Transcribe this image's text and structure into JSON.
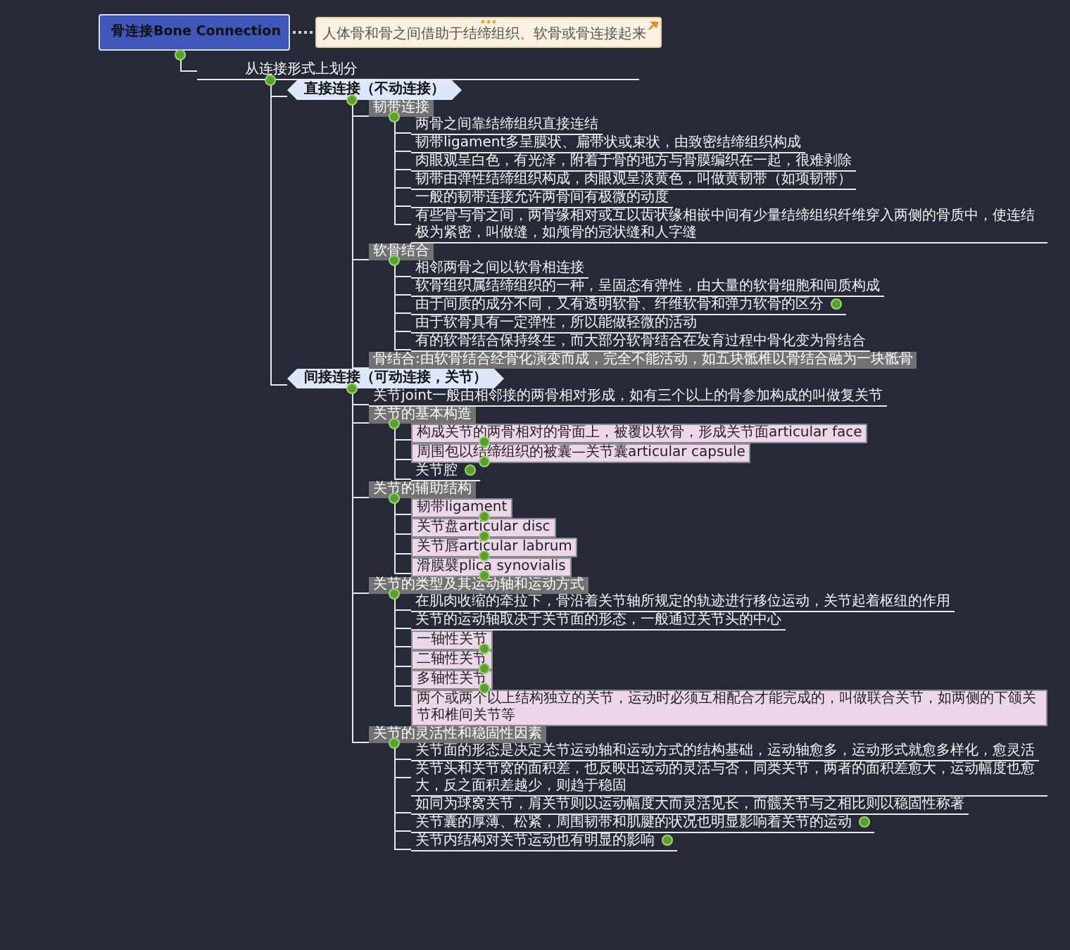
{
  "root": {
    "title": "骨连接Bone Connection",
    "note": {
      "text": "人体骨和骨之间借助于结缔组织、软骨或骨连接起来"
    },
    "children": [
      {
        "kind": "branch",
        "text": "从连接形式上划分",
        "children": [
          {
            "kind": "main",
            "text": "直接连接（不动连接）",
            "children": [
              {
                "kind": "grey",
                "text": "韧带连接",
                "children": [
                  {
                    "kind": "plain",
                    "text": "两骨之间靠结缔组织直接连结"
                  },
                  {
                    "kind": "plain",
                    "text": "韧带ligament多呈膜状、扁带状或束状，由致密结缔组织构成"
                  },
                  {
                    "kind": "plain",
                    "text": "肉眼观呈白色，有光泽，附着于骨的地方与骨膜编织在一起，很难剥除"
                  },
                  {
                    "kind": "plain",
                    "text": "韧带由弹性结缔组织构成，肉眼观呈淡黄色，叫做黄韧带（如项韧带）"
                  },
                  {
                    "kind": "plain",
                    "text": "一般的韧带连接允许两骨间有极微的动度"
                  },
                  {
                    "kind": "plain",
                    "text": "有些骨与骨之间，两骨缘相对或互以齿状缘相嵌中间有少量结缔组织纤维穿入两侧的骨质中，使连结极为紧密，叫做缝，如颅骨的冠状缝和人字缝"
                  }
                ]
              },
              {
                "kind": "grey",
                "text": "软骨结合",
                "children": [
                  {
                    "kind": "plain",
                    "text": "相邻两骨之间以软骨相连接",
                    "collapsed": false
                  },
                  {
                    "kind": "plain",
                    "text": "软骨组织属结缔组织的一种，呈固态有弹性，由大量的软骨细胞和间质构成",
                    "collapsed": false
                  },
                  {
                    "kind": "plain",
                    "text": "由于间质的成分不同，又有透明软骨、纤维软骨和弹力软骨的区分",
                    "collapsed": true
                  },
                  {
                    "kind": "plain",
                    "text": "由于软骨具有一定弹性，所以能做轻微的活动",
                    "collapsed": false
                  },
                  {
                    "kind": "plain",
                    "text": "有的软骨结合保持终生，而大部分软骨结合在发育过程中骨化变为骨结合",
                    "collapsed": false
                  }
                ]
              },
              {
                "kind": "grey",
                "text": "骨结合:由软骨结合经骨化演变而成，完全不能活动，如五块骶椎以骨结合融为一块骶骨"
              }
            ]
          },
          {
            "kind": "main",
            "text": "间接连接（可动连接，关节）",
            "children": [
              {
                "kind": "plain",
                "text": "关节joint一般由相邻接的两骨相对形成，如有三个以上的骨参加构成的叫做复关节"
              },
              {
                "kind": "grey",
                "text": "关节的基本构造",
                "children": [
                  {
                    "kind": "pink",
                    "text": "构成关节的两骨相对的骨面上，被覆以软骨，形成关节面articular face",
                    "collapsed": true
                  },
                  {
                    "kind": "pink",
                    "text": "周围包以结缔组织的被囊—关节囊articular capsule",
                    "collapsed": true
                  },
                  {
                    "kind": "plain",
                    "text": "关节腔",
                    "collapsed": true
                  }
                ]
              },
              {
                "kind": "grey",
                "text": "关节的辅助结构",
                "children": [
                  {
                    "kind": "pink",
                    "text": "韧带ligament",
                    "collapsed": true
                  },
                  {
                    "kind": "pink",
                    "text": "关节盘articular disc",
                    "collapsed": true
                  },
                  {
                    "kind": "pink",
                    "text": "关节唇articular labrum",
                    "collapsed": true
                  },
                  {
                    "kind": "pink",
                    "text": "滑膜襞plica synovialis",
                    "collapsed": true
                  }
                ]
              },
              {
                "kind": "grey",
                "text": "关节的类型及其运动轴和运动方式",
                "children": [
                  {
                    "kind": "plain",
                    "text": "在肌肉收缩的牵拉下，骨沿着关节轴所规定的轨迹进行移位运动，关节起着枢纽的作用",
                    "collapsed": false
                  },
                  {
                    "kind": "plain",
                    "text": "关节的运动轴取决于关节面的形态，一般通过关节头的中心",
                    "collapsed": false
                  },
                  {
                    "kind": "pink",
                    "text": "一轴性关节",
                    "collapsed": true
                  },
                  {
                    "kind": "pink",
                    "text": "二轴性关节",
                    "collapsed": true
                  },
                  {
                    "kind": "pink",
                    "text": "多轴性关节",
                    "collapsed": true
                  },
                  {
                    "kind": "pink",
                    "text": "两个或两个以上结构独立的关节，运动时必须互相配合才能完成的，叫做联合关节，如两侧的下颌关节和椎间关节等",
                    "collapsed": false
                  }
                ]
              },
              {
                "kind": "grey",
                "text": "关节的灵活性和稳固性因素",
                "children": [
                  {
                    "kind": "plain",
                    "text": "关节面的形态是决定关节运动轴和运动方式的结构基础，运动轴愈多，运动形式就愈多样化，愈灵活",
                    "collapsed": false
                  },
                  {
                    "kind": "plain",
                    "text": "关节头和关节窝的面积差，也反映出运动的灵活与否，同类关节，两者的面积差愈大，运动幅度也愈大，反之面积差越少，则趋于稳固",
                    "collapsed": false
                  },
                  {
                    "kind": "plain",
                    "text": "如同为球窝关节，肩关节则以运动幅度大而灵活见长，而髋关节与之相比则以稳固性称著",
                    "collapsed": false
                  },
                  {
                    "kind": "plain",
                    "text": "关节囊的厚薄、松紧，周围韧带和肌腱的状况也明显影响着关节的运动",
                    "collapsed": true
                  },
                  {
                    "kind": "plain",
                    "text": "关节内结构对关节运动也有明显的影响",
                    "collapsed": true
                  }
                ]
              }
            ]
          }
        ]
      }
    ]
  }
}
